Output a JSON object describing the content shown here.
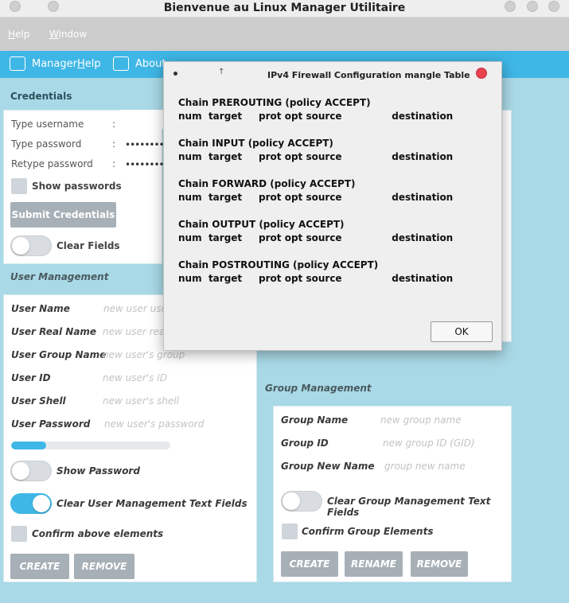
{
  "window": {
    "title": "Bienvenue au Linux Manager Utilitaire"
  },
  "menubar": {
    "help_prefix": "",
    "help_underlined": "H",
    "help_rest": "elp",
    "window_underlined": "W",
    "window_rest": "indow"
  },
  "toolbar": {
    "manager_help": "Manager ",
    "manager_help_underlined": "H",
    "manager_help_rest": "elp",
    "about": "About"
  },
  "credentials": {
    "title": "Credentials",
    "username_label": "Type username",
    "password_label": "Type password",
    "retype_label": "Retype password",
    "colon": ":",
    "password_dots": "•••••••••",
    "retype_dots": "•••••••••",
    "show_passwords": "Show passwords",
    "submit": "Submit Credentials",
    "clear_fields": "Clear Fields"
  },
  "user_management": {
    "title": "User Management",
    "fields": [
      {
        "label": "User Name",
        "placeholder": "new user use"
      },
      {
        "label": "User Real Name",
        "placeholder": "new user real"
      },
      {
        "label": "User Group Name",
        "placeholder": "new user's group"
      },
      {
        "label": "User ID",
        "placeholder": "new user's ID"
      },
      {
        "label": "User Shell",
        "placeholder": "new user's shell"
      },
      {
        "label": "User Password",
        "placeholder": "new user's password"
      }
    ],
    "progress": 0.22,
    "show_password": "Show Password",
    "clear_text_fields": "Clear User Management Text Fields",
    "confirm": "Confirm above elements",
    "create": "CREATE",
    "remove": "REMOVE"
  },
  "group_management": {
    "title": "Group Management",
    "fields": [
      {
        "label": "Group Name",
        "placeholder": "new group name"
      },
      {
        "label": "Group ID",
        "placeholder": "new group ID (GID)"
      },
      {
        "label": "Group New Name",
        "placeholder": "group new name"
      }
    ],
    "clear_text_fields": "Clear Group Management Text Fields",
    "confirm": "Confirm Group Elements",
    "create": "CREATE",
    "rename": "RENAME",
    "remove": "REMOVE"
  },
  "dialog": {
    "title": "IPv4 Firewall Configuration mangle Table",
    "chains": [
      {
        "title": "Chain PREROUTING (policy ACCEPT)",
        "header": "num  target     prot opt source               destination"
      },
      {
        "title": "Chain INPUT (policy ACCEPT)",
        "header": "num  target     prot opt source               destination"
      },
      {
        "title": "Chain FORWARD (policy ACCEPT)",
        "header": "num  target     prot opt source               destination"
      },
      {
        "title": "Chain OUTPUT (policy ACCEPT)",
        "header": "num  target     prot opt source               destination"
      },
      {
        "title": "Chain POSTROUTING (policy ACCEPT)",
        "header": "num  target     prot opt source               destination"
      }
    ],
    "ok": "OK"
  },
  "colors": {
    "accent": "#3fb7e6",
    "background": "#a9d9e6",
    "close": "#e8424e"
  }
}
